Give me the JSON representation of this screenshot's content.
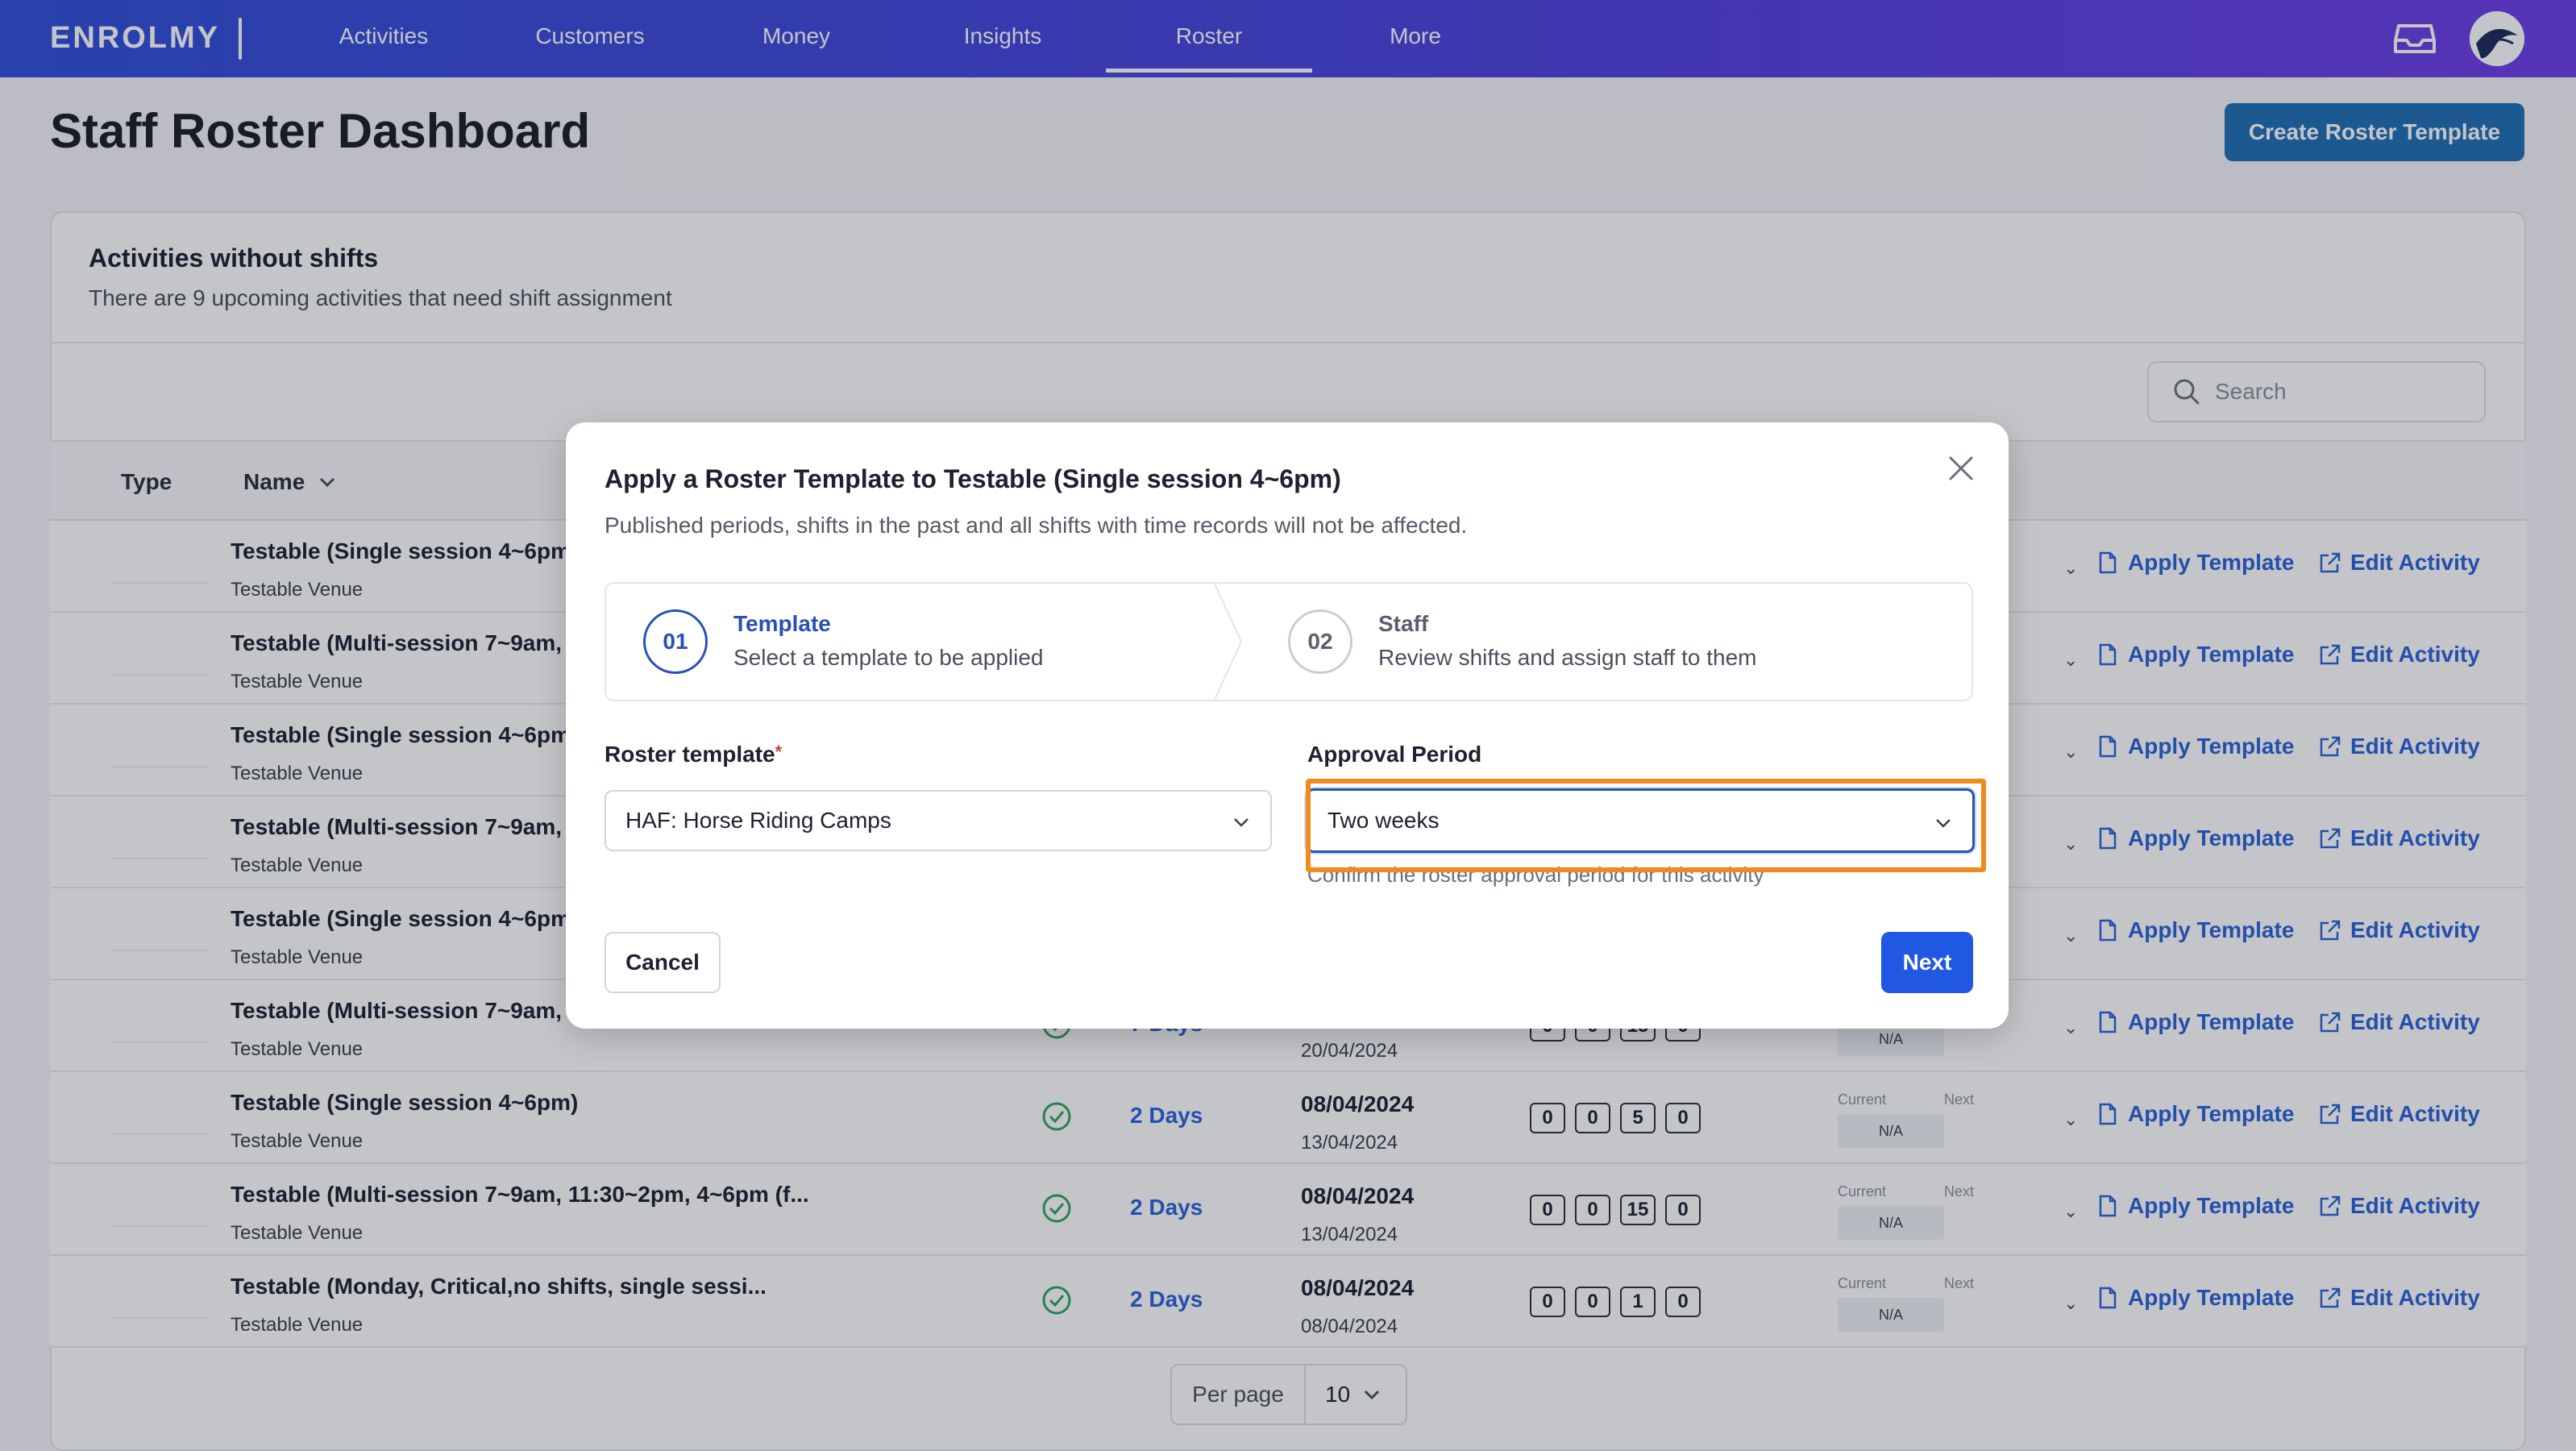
{
  "app": {
    "logo": "ENROLMY"
  },
  "nav": {
    "items": [
      {
        "label": "Activities"
      },
      {
        "label": "Customers"
      },
      {
        "label": "Money"
      },
      {
        "label": "Insights"
      },
      {
        "label": "Roster"
      },
      {
        "label": "More"
      }
    ],
    "active": "Roster"
  },
  "page": {
    "title": "Staff Roster Dashboard",
    "create_button": "Create Roster Template"
  },
  "card": {
    "title": "Activities without shifts",
    "subtitle": "There are 9 upcoming activities that need shift assignment",
    "search_placeholder": "Search",
    "columns": {
      "type": "Type",
      "name": "Name"
    }
  },
  "rows": [
    {
      "name": "Testable (Single session 4~6pm",
      "venue": "Testable Venue",
      "days": "",
      "date1": "",
      "date2": "",
      "counts": [],
      "na": ""
    },
    {
      "name": "Testable (Multi-session 7~9am,",
      "venue": "Testable Venue",
      "days": "",
      "date1": "",
      "date2": "",
      "counts": [],
      "na": ""
    },
    {
      "name": "Testable (Single session 4~6pm",
      "venue": "Testable Venue",
      "days": "",
      "date1": "",
      "date2": "",
      "counts": [],
      "na": ""
    },
    {
      "name": "Testable (Multi-session 7~9am,",
      "venue": "Testable Venue",
      "days": "",
      "date1": "",
      "date2": "",
      "counts": [],
      "na": ""
    },
    {
      "name": "Testable (Single session 4~6pm",
      "venue": "Testable Venue",
      "days": "",
      "date1": "",
      "date2": "",
      "counts": [],
      "na": ""
    },
    {
      "name": "Testable (Multi-session 7~9am,",
      "venue": "Testable Venue",
      "days": "7 Days",
      "date1": "",
      "date2": "20/04/2024",
      "counts": [
        "0",
        "0",
        "15",
        "0"
      ],
      "na": "N/A"
    },
    {
      "name": "Testable (Single session 4~6pm)",
      "venue": "Testable Venue",
      "days": "2 Days",
      "date1": "08/04/2024",
      "date2": "13/04/2024",
      "counts": [
        "0",
        "0",
        "5",
        "0"
      ],
      "na": "N/A"
    },
    {
      "name": "Testable (Multi-session 7~9am, 11:30~2pm, 4~6pm (f...",
      "venue": "Testable Venue",
      "days": "2 Days",
      "date1": "08/04/2024",
      "date2": "13/04/2024",
      "counts": [
        "0",
        "0",
        "15",
        "0"
      ],
      "na": "N/A"
    },
    {
      "name": "Testable (Monday, Critical,no shifts, single sessi...",
      "venue": "Testable Venue",
      "days": "2 Days",
      "date1": "08/04/2024",
      "date2": "08/04/2024",
      "counts": [
        "0",
        "0",
        "1",
        "0"
      ],
      "na": "N/A"
    }
  ],
  "row_labels": {
    "current": "Current",
    "next": "Next",
    "apply": "Apply Template",
    "edit": "Edit Activity"
  },
  "pager": {
    "label": "Per page",
    "value": "10"
  },
  "modal": {
    "title": "Apply a Roster Template to Testable (Single session 4~6pm)",
    "subtitle": "Published periods, shifts in the past and all shifts with time records will not be affected.",
    "steps": [
      {
        "num": "01",
        "title": "Template",
        "desc": "Select a template to be applied"
      },
      {
        "num": "02",
        "title": "Staff",
        "desc": "Review shifts and assign staff to them"
      }
    ],
    "roster_label": "Roster template",
    "required_mark": "*",
    "roster_value": "HAF: Horse Riding Camps",
    "approval_label": "Approval Period",
    "approval_value": "Two weeks",
    "approval_hint": "Confirm the roster approval period for this activity",
    "cancel": "Cancel",
    "next": "Next"
  },
  "colors": {
    "accent": "#2158e2",
    "nav_start": "#2f4fd8",
    "nav_end": "#6d3ee6",
    "highlight": "#f08a1c",
    "link": "#2a62d8"
  }
}
